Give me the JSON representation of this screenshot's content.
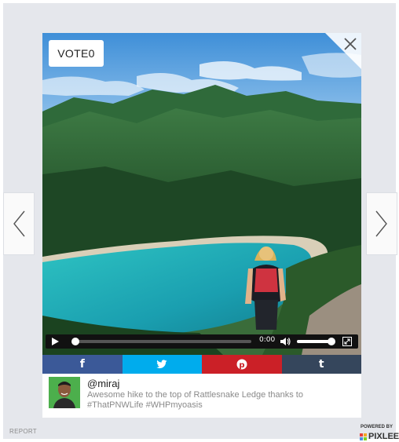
{
  "widget": {
    "vote_label": "VOTE0",
    "report_label": "REPORT",
    "powered_by_label": "POWERED BY",
    "brand_name": "PIXLEE"
  },
  "video": {
    "time": "0:00",
    "progress": 0,
    "volume": 1.0
  },
  "share": [
    {
      "network": "facebook",
      "glyph": "f",
      "color": "#3b5998"
    },
    {
      "network": "twitter",
      "glyph": "twitter-bird-icon",
      "color": "#00aced"
    },
    {
      "network": "pinterest",
      "glyph": "p",
      "color": "#cb2027"
    },
    {
      "network": "tumblr",
      "glyph": "t",
      "color": "#35465c"
    }
  ],
  "post": {
    "handle": "@miraj",
    "caption": "Awesome hike to the top of Rattlesnake Ledge thanks to #ThatPNWLife #WHPmyoasis"
  },
  "colors": {
    "background": "#e5e7ec",
    "card": "#ffffff",
    "facebook": "#3b5998",
    "twitter": "#00aced",
    "pinterest": "#cb2027",
    "tumblr": "#35465c"
  }
}
